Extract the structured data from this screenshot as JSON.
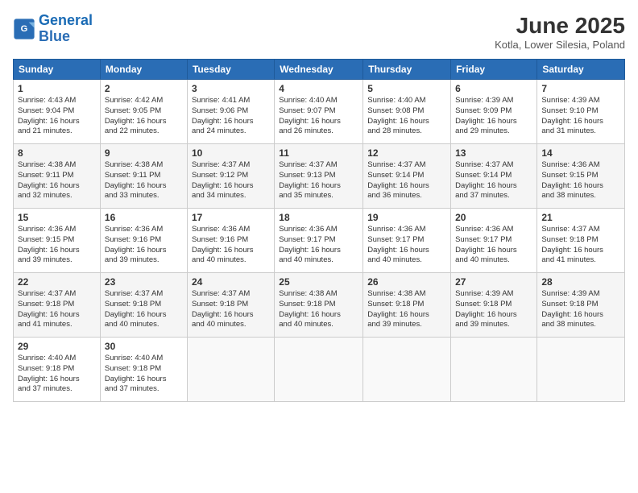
{
  "header": {
    "logo_line1": "General",
    "logo_line2": "Blue",
    "month_title": "June 2025",
    "location": "Kotla, Lower Silesia, Poland"
  },
  "weekdays": [
    "Sunday",
    "Monday",
    "Tuesday",
    "Wednesday",
    "Thursday",
    "Friday",
    "Saturday"
  ],
  "weeks": [
    [
      {
        "day": "1",
        "info": "Sunrise: 4:43 AM\nSunset: 9:04 PM\nDaylight: 16 hours\nand 21 minutes."
      },
      {
        "day": "2",
        "info": "Sunrise: 4:42 AM\nSunset: 9:05 PM\nDaylight: 16 hours\nand 22 minutes."
      },
      {
        "day": "3",
        "info": "Sunrise: 4:41 AM\nSunset: 9:06 PM\nDaylight: 16 hours\nand 24 minutes."
      },
      {
        "day": "4",
        "info": "Sunrise: 4:40 AM\nSunset: 9:07 PM\nDaylight: 16 hours\nand 26 minutes."
      },
      {
        "day": "5",
        "info": "Sunrise: 4:40 AM\nSunset: 9:08 PM\nDaylight: 16 hours\nand 28 minutes."
      },
      {
        "day": "6",
        "info": "Sunrise: 4:39 AM\nSunset: 9:09 PM\nDaylight: 16 hours\nand 29 minutes."
      },
      {
        "day": "7",
        "info": "Sunrise: 4:39 AM\nSunset: 9:10 PM\nDaylight: 16 hours\nand 31 minutes."
      }
    ],
    [
      {
        "day": "8",
        "info": "Sunrise: 4:38 AM\nSunset: 9:11 PM\nDaylight: 16 hours\nand 32 minutes."
      },
      {
        "day": "9",
        "info": "Sunrise: 4:38 AM\nSunset: 9:11 PM\nDaylight: 16 hours\nand 33 minutes."
      },
      {
        "day": "10",
        "info": "Sunrise: 4:37 AM\nSunset: 9:12 PM\nDaylight: 16 hours\nand 34 minutes."
      },
      {
        "day": "11",
        "info": "Sunrise: 4:37 AM\nSunset: 9:13 PM\nDaylight: 16 hours\nand 35 minutes."
      },
      {
        "day": "12",
        "info": "Sunrise: 4:37 AM\nSunset: 9:14 PM\nDaylight: 16 hours\nand 36 minutes."
      },
      {
        "day": "13",
        "info": "Sunrise: 4:37 AM\nSunset: 9:14 PM\nDaylight: 16 hours\nand 37 minutes."
      },
      {
        "day": "14",
        "info": "Sunrise: 4:36 AM\nSunset: 9:15 PM\nDaylight: 16 hours\nand 38 minutes."
      }
    ],
    [
      {
        "day": "15",
        "info": "Sunrise: 4:36 AM\nSunset: 9:15 PM\nDaylight: 16 hours\nand 39 minutes."
      },
      {
        "day": "16",
        "info": "Sunrise: 4:36 AM\nSunset: 9:16 PM\nDaylight: 16 hours\nand 39 minutes."
      },
      {
        "day": "17",
        "info": "Sunrise: 4:36 AM\nSunset: 9:16 PM\nDaylight: 16 hours\nand 40 minutes."
      },
      {
        "day": "18",
        "info": "Sunrise: 4:36 AM\nSunset: 9:17 PM\nDaylight: 16 hours\nand 40 minutes."
      },
      {
        "day": "19",
        "info": "Sunrise: 4:36 AM\nSunset: 9:17 PM\nDaylight: 16 hours\nand 40 minutes."
      },
      {
        "day": "20",
        "info": "Sunrise: 4:36 AM\nSunset: 9:17 PM\nDaylight: 16 hours\nand 40 minutes."
      },
      {
        "day": "21",
        "info": "Sunrise: 4:37 AM\nSunset: 9:18 PM\nDaylight: 16 hours\nand 41 minutes."
      }
    ],
    [
      {
        "day": "22",
        "info": "Sunrise: 4:37 AM\nSunset: 9:18 PM\nDaylight: 16 hours\nand 41 minutes."
      },
      {
        "day": "23",
        "info": "Sunrise: 4:37 AM\nSunset: 9:18 PM\nDaylight: 16 hours\nand 40 minutes."
      },
      {
        "day": "24",
        "info": "Sunrise: 4:37 AM\nSunset: 9:18 PM\nDaylight: 16 hours\nand 40 minutes."
      },
      {
        "day": "25",
        "info": "Sunrise: 4:38 AM\nSunset: 9:18 PM\nDaylight: 16 hours\nand 40 minutes."
      },
      {
        "day": "26",
        "info": "Sunrise: 4:38 AM\nSunset: 9:18 PM\nDaylight: 16 hours\nand 39 minutes."
      },
      {
        "day": "27",
        "info": "Sunrise: 4:39 AM\nSunset: 9:18 PM\nDaylight: 16 hours\nand 39 minutes."
      },
      {
        "day": "28",
        "info": "Sunrise: 4:39 AM\nSunset: 9:18 PM\nDaylight: 16 hours\nand 38 minutes."
      }
    ],
    [
      {
        "day": "29",
        "info": "Sunrise: 4:40 AM\nSunset: 9:18 PM\nDaylight: 16 hours\nand 37 minutes."
      },
      {
        "day": "30",
        "info": "Sunrise: 4:40 AM\nSunset: 9:18 PM\nDaylight: 16 hours\nand 37 minutes."
      },
      {
        "day": "",
        "info": ""
      },
      {
        "day": "",
        "info": ""
      },
      {
        "day": "",
        "info": ""
      },
      {
        "day": "",
        "info": ""
      },
      {
        "day": "",
        "info": ""
      }
    ]
  ]
}
